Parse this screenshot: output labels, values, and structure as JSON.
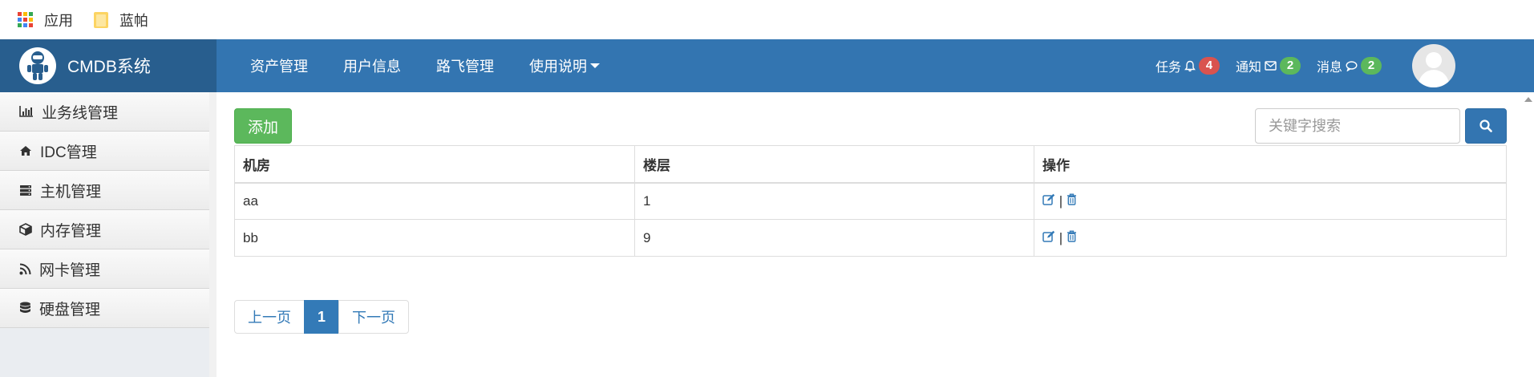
{
  "bookmarks": {
    "apps_label": "应用",
    "folder_label": "蓝帕",
    "apps_colors": [
      "#ea4335",
      "#fbbc05",
      "#34a853",
      "#4285f4",
      "#ea4335",
      "#fbbc05",
      "#34a853",
      "#4285f4",
      "#ea4335"
    ]
  },
  "navbar": {
    "brand": "CMDB系统",
    "links": [
      "资产管理",
      "用户信息",
      "路飞管理",
      "使用说明"
    ],
    "tasks_label": "任务",
    "tasks_count": "4",
    "notify_label": "通知",
    "notify_count": "2",
    "messages_label": "消息",
    "messages_count": "2",
    "bg_color": "#3375b1",
    "brand_bg_color": "#285e8e"
  },
  "sidebar": {
    "items": [
      {
        "label": "业务线管理",
        "icon": "bar-chart-icon"
      },
      {
        "label": "IDC管理",
        "icon": "home-icon"
      },
      {
        "label": "主机管理",
        "icon": "server-icon"
      },
      {
        "label": "内存管理",
        "icon": "cube-icon"
      },
      {
        "label": "网卡管理",
        "icon": "rss-icon"
      },
      {
        "label": "硬盘管理",
        "icon": "database-icon"
      }
    ]
  },
  "main": {
    "add_label": "添加",
    "search_placeholder": "关键字搜索",
    "table": {
      "headers": [
        "机房",
        "楼层",
        "操作"
      ],
      "rows": [
        {
          "room": "aa",
          "floor": "1"
        },
        {
          "room": "bb",
          "floor": "9"
        }
      ],
      "op_separator": "|"
    },
    "pager": {
      "prev": "上一页",
      "current": "1",
      "next": "下一页"
    }
  }
}
